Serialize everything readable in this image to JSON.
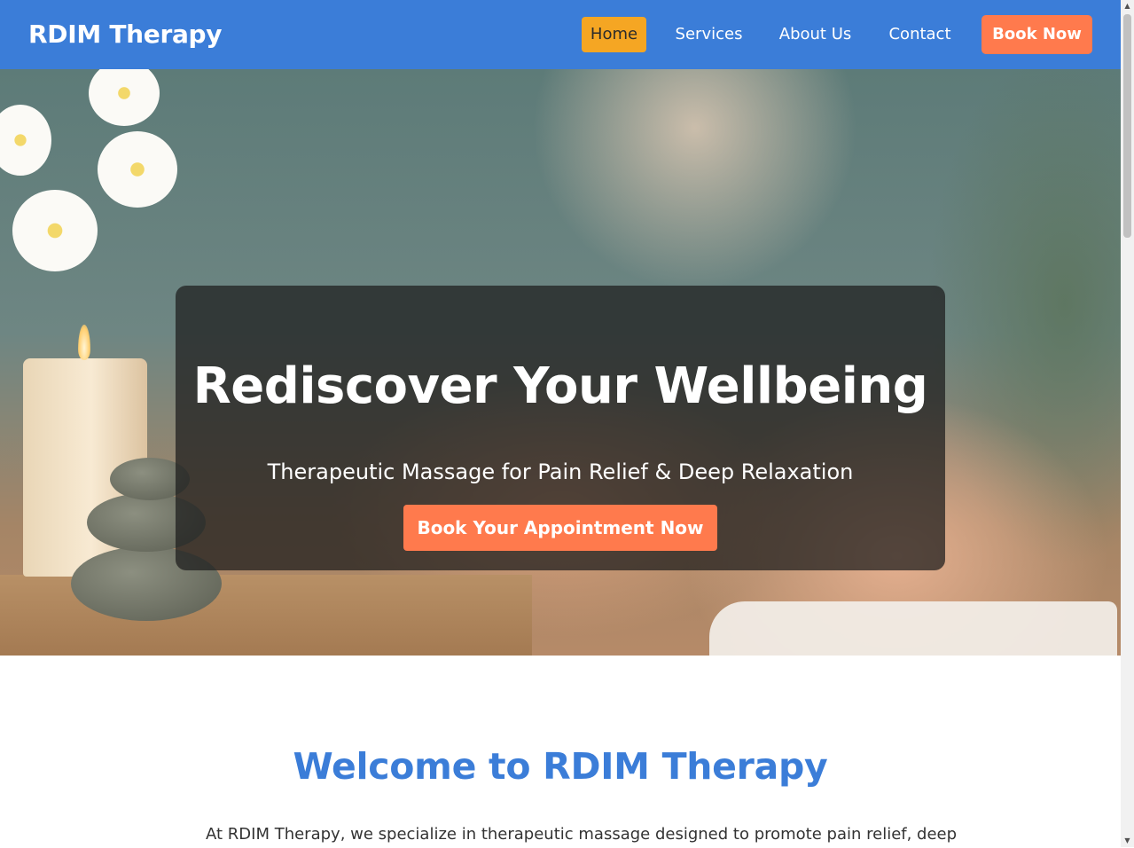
{
  "navbar": {
    "brand": "RDIM Therapy",
    "links": [
      {
        "label": "Home",
        "active": true
      },
      {
        "label": "Services",
        "active": false
      },
      {
        "label": "About Us",
        "active": false
      },
      {
        "label": "Contact",
        "active": false
      }
    ],
    "cta_label": "Book Now"
  },
  "hero": {
    "title": "Rediscover Your Wellbeing",
    "subtitle": "Therapeutic Massage for Pain Relief & Deep Relaxation",
    "cta_label": "Book Your Appointment Now"
  },
  "welcome": {
    "title": "Welcome to RDIM Therapy",
    "text": "At RDIM Therapy, we specialize in therapeutic massage designed to promote pain relief, deep"
  },
  "colors": {
    "primary": "#3b7dd8",
    "active_nav": "#f5a623",
    "accent": "#ff7a4d",
    "hero_overlay": "rgba(28,28,28,0.72)"
  },
  "icons": {
    "scroll_up": "triangle-up-icon",
    "scroll_down": "triangle-down-icon"
  }
}
